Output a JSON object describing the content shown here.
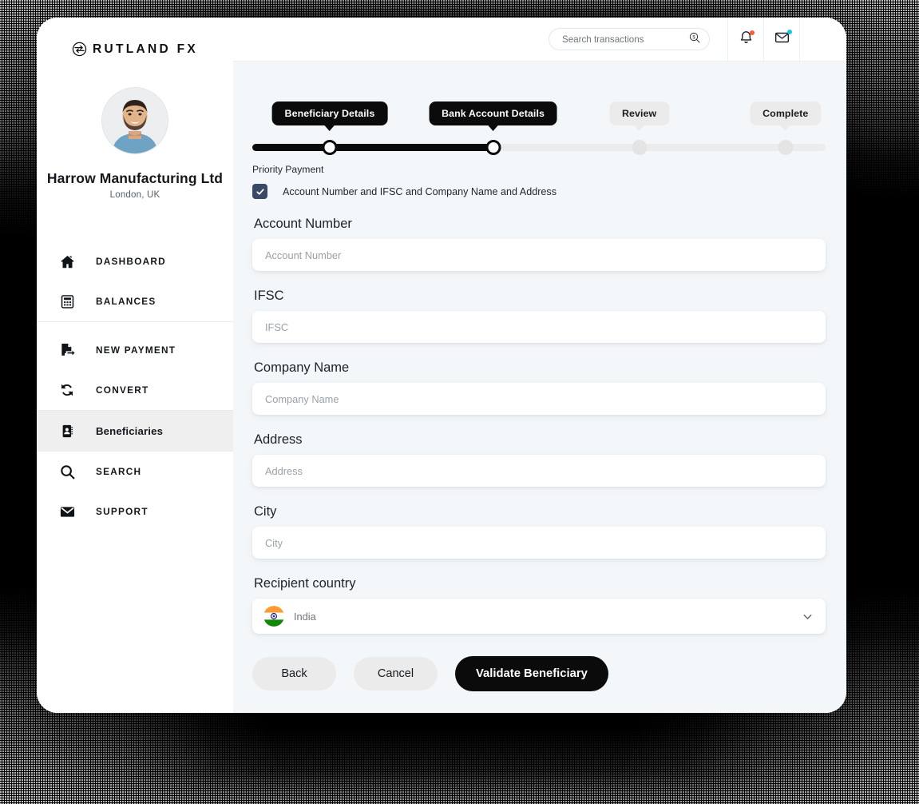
{
  "brand": {
    "name": "RUTLAND FX",
    "logo_icon": "exchange-circle-icon"
  },
  "sidebar": {
    "profile": {
      "avatar_icon": "user-avatar-photo",
      "name": "Harrow Manufacturing Ltd",
      "location": "London, UK"
    },
    "items": [
      {
        "label": "DASHBOARD",
        "icon": "home-icon",
        "active": false
      },
      {
        "label": "BALANCES",
        "icon": "calculator-icon",
        "active": false
      },
      {
        "label": "NEW PAYMENT",
        "icon": "document-send-icon",
        "active": false
      },
      {
        "label": "CONVERT",
        "icon": "refresh-icon",
        "active": false
      },
      {
        "label": "Beneficiaries",
        "icon": "address-book-icon",
        "active": true
      },
      {
        "label": "SEARCH",
        "icon": "magnifier-icon",
        "active": false
      },
      {
        "label": "SUPPORT",
        "icon": "envelope-icon",
        "active": false
      }
    ]
  },
  "topbar": {
    "search": {
      "placeholder": "Search transactions",
      "value": "",
      "icon": "search-dollar-icon"
    },
    "notifications": {
      "icon": "bell-icon",
      "badge_color": "#fa5a3d",
      "has_badge": true
    },
    "messages": {
      "icon": "envelope-icon",
      "badge_color": "#19c8d8",
      "has_badge": true
    }
  },
  "stepper": {
    "steps": [
      {
        "label": "Beneficiary Details",
        "state": "done"
      },
      {
        "label": "Bank Account Details",
        "state": "done"
      },
      {
        "label": "Review",
        "state": "todo"
      },
      {
        "label": "Complete",
        "state": "todo"
      }
    ],
    "progress_percent": 42,
    "colors": {
      "active": "#0b0b0b",
      "inactive": "#ebebeb",
      "track": "#ececed"
    }
  },
  "form": {
    "priority_label": "Priority Payment",
    "priority_option": {
      "label": "Account Number and IFSC and Company Name and Address",
      "checked": true,
      "color": "#3b4868"
    },
    "fields": [
      {
        "label": "Account Number",
        "placeholder": "Account Number",
        "value": ""
      },
      {
        "label": "IFSC",
        "placeholder": "IFSC",
        "value": ""
      },
      {
        "label": "Company Name",
        "placeholder": "Company Name",
        "value": ""
      },
      {
        "label": "Address",
        "placeholder": "Address",
        "value": ""
      },
      {
        "label": "City",
        "placeholder": "City",
        "value": ""
      }
    ],
    "country": {
      "label": "Recipient country",
      "value": "India",
      "flag_icon": "india-flag-icon",
      "chevron_icon": "chevron-down-icon"
    }
  },
  "actions": {
    "back": "Back",
    "cancel": "Cancel",
    "submit": "Validate Beneficiary"
  }
}
